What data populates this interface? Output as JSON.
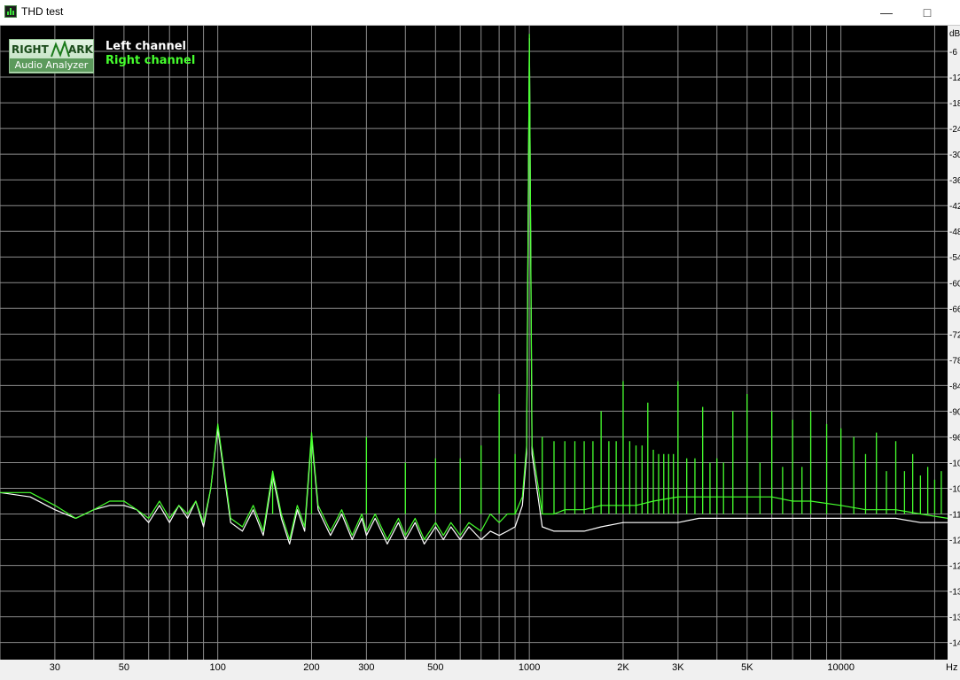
{
  "window": {
    "title": "THD test",
    "minimize_glyph": "—",
    "maximize_glyph": "□"
  },
  "logo": {
    "line1_left": "RIGHT",
    "line1_right": "ARK",
    "line2": "Audio Analyzer"
  },
  "colors": {
    "background": "#000000",
    "grid": "#8c8c8c",
    "left_channel": "#ffffff",
    "right_channel": "#46ff2e",
    "axis_panel": "#f0f0f0"
  },
  "chart_data": {
    "type": "line",
    "title": "",
    "xlabel": "Hz",
    "ylabel": "dB",
    "x_scale": "log",
    "xlim": [
      20,
      22000
    ],
    "ylim": [
      -148,
      0
    ],
    "grid": true,
    "legend_placement": "top-left",
    "x_tick_labels": [
      "30",
      "50",
      "100",
      "200",
      "300",
      "500",
      "1000",
      "2K",
      "3K",
      "5K",
      "10000"
    ],
    "y_tick_labels": [
      "-6",
      "-12",
      "-18",
      "-24",
      "-30",
      "-36",
      "-42",
      "-48",
      "-54",
      "-60",
      "-66",
      "-72",
      "-78",
      "-84",
      "-90",
      "-96",
      "-10",
      "-10",
      "-11",
      "-12",
      "-12",
      "-13",
      "-13",
      "-14"
    ],
    "series": [
      {
        "name": "Left channel",
        "color": "#ffffff",
        "x": [
          20,
          25,
          30,
          35,
          40,
          45,
          50,
          55,
          60,
          65,
          70,
          75,
          80,
          85,
          90,
          95,
          100,
          110,
          120,
          130,
          140,
          150,
          160,
          170,
          180,
          190,
          200,
          210,
          230,
          250,
          270,
          290,
          300,
          320,
          350,
          380,
          400,
          430,
          460,
          500,
          530,
          560,
          600,
          640,
          700,
          750,
          800,
          850,
          900,
          950,
          980,
          1000,
          1020,
          1100,
          1200,
          1300,
          1500,
          1700,
          2000,
          2200,
          2500,
          3000,
          3500,
          4000,
          5000,
          6000,
          7000,
          8000,
          10000,
          12000,
          15000,
          18000,
          22000
        ],
        "y": [
          -109,
          -110,
          -113,
          -115,
          -113,
          -112,
          -112,
          -113,
          -116,
          -112,
          -116,
          -112,
          -115,
          -111,
          -117,
          -108,
          -94,
          -116,
          -118,
          -113,
          -119,
          -105,
          -115,
          -121,
          -113,
          -118,
          -96,
          -113,
          -119,
          -114,
          -120,
          -115,
          -119,
          -115,
          -121,
          -116,
          -120,
          -116,
          -121,
          -117,
          -120,
          -117,
          -120,
          -117,
          -120,
          -118,
          -119,
          -118,
          -117,
          -112,
          -100,
          -3,
          -100,
          -117,
          -118,
          -118,
          -118,
          -117,
          -116,
          -116,
          -116,
          -116,
          -115,
          -115,
          -115,
          -115,
          -115,
          -115,
          -115,
          -115,
          -115,
          -116,
          -116
        ]
      },
      {
        "name": "Right channel",
        "color": "#46ff2e",
        "x": [
          20,
          25,
          30,
          35,
          40,
          45,
          50,
          55,
          60,
          65,
          70,
          75,
          80,
          85,
          90,
          95,
          100,
          110,
          120,
          130,
          140,
          150,
          160,
          170,
          180,
          190,
          200,
          210,
          230,
          250,
          270,
          290,
          300,
          320,
          350,
          380,
          400,
          430,
          460,
          500,
          530,
          560,
          600,
          640,
          700,
          750,
          800,
          850,
          900,
          950,
          980,
          1000,
          1020,
          1100,
          1200,
          1300,
          1500,
          1700,
          2000,
          2200,
          2500,
          3000,
          3500,
          4000,
          5000,
          6000,
          7000,
          8000,
          10000,
          12000,
          15000,
          18000,
          22000
        ],
        "y": [
          -109,
          -109,
          -112,
          -115,
          -113,
          -111,
          -111,
          -113,
          -115,
          -111,
          -115,
          -112,
          -114,
          -111,
          -116,
          -108,
          -93,
          -115,
          -117,
          -112,
          -118,
          -104,
          -114,
          -120,
          -112,
          -117,
          -95,
          -112,
          -118,
          -113,
          -119,
          -114,
          -118,
          -114,
          -120,
          -115,
          -119,
          -115,
          -120,
          -116,
          -119,
          -116,
          -119,
          -116,
          -118,
          -114,
          -116,
          -114,
          -114,
          -110,
          -98,
          -2,
          -98,
          -114,
          -114,
          -113,
          -113,
          -112,
          -112,
          -112,
          -111,
          -110,
          -110,
          -110,
          -110,
          -110,
          -111,
          -111,
          -112,
          -113,
          -113,
          -114,
          -115
        ]
      }
    ],
    "harmonic_peaks": [
      {
        "x": 150,
        "y": -105
      },
      {
        "x": 200,
        "y": -96
      },
      {
        "x": 300,
        "y": -96
      },
      {
        "x": 400,
        "y": -102
      },
      {
        "x": 500,
        "y": -101
      },
      {
        "x": 600,
        "y": -101
      },
      {
        "x": 700,
        "y": -98
      },
      {
        "x": 800,
        "y": -86
      },
      {
        "x": 900,
        "y": -100
      },
      {
        "x": 1100,
        "y": -96
      },
      {
        "x": 1200,
        "y": -97
      },
      {
        "x": 1300,
        "y": -97
      },
      {
        "x": 1400,
        "y": -97
      },
      {
        "x": 1500,
        "y": -97
      },
      {
        "x": 1600,
        "y": -97
      },
      {
        "x": 1700,
        "y": -90
      },
      {
        "x": 1800,
        "y": -97
      },
      {
        "x": 1900,
        "y": -97
      },
      {
        "x": 2000,
        "y": -83
      },
      {
        "x": 2100,
        "y": -97
      },
      {
        "x": 2200,
        "y": -98
      },
      {
        "x": 2300,
        "y": -98
      },
      {
        "x": 2400,
        "y": -88
      },
      {
        "x": 2500,
        "y": -99
      },
      {
        "x": 2600,
        "y": -100
      },
      {
        "x": 2700,
        "y": -100
      },
      {
        "x": 2800,
        "y": -100
      },
      {
        "x": 2900,
        "y": -100
      },
      {
        "x": 3000,
        "y": -83
      },
      {
        "x": 3200,
        "y": -101
      },
      {
        "x": 3400,
        "y": -101
      },
      {
        "x": 3600,
        "y": -89
      },
      {
        "x": 3800,
        "y": -102
      },
      {
        "x": 4000,
        "y": -101
      },
      {
        "x": 4200,
        "y": -102
      },
      {
        "x": 4500,
        "y": -90
      },
      {
        "x": 5000,
        "y": -86
      },
      {
        "x": 5500,
        "y": -102
      },
      {
        "x": 6000,
        "y": -90
      },
      {
        "x": 6500,
        "y": -103
      },
      {
        "x": 7000,
        "y": -92
      },
      {
        "x": 7500,
        "y": -103
      },
      {
        "x": 8000,
        "y": -90
      },
      {
        "x": 9000,
        "y": -93
      },
      {
        "x": 10000,
        "y": -94
      },
      {
        "x": 11000,
        "y": -96
      },
      {
        "x": 12000,
        "y": -100
      },
      {
        "x": 13000,
        "y": -95
      },
      {
        "x": 14000,
        "y": -104
      },
      {
        "x": 15000,
        "y": -97
      },
      {
        "x": 16000,
        "y": -104
      },
      {
        "x": 17000,
        "y": -100
      },
      {
        "x": 18000,
        "y": -105
      },
      {
        "x": 19000,
        "y": -103
      },
      {
        "x": 20000,
        "y": -106
      },
      {
        "x": 21000,
        "y": -104
      }
    ]
  }
}
